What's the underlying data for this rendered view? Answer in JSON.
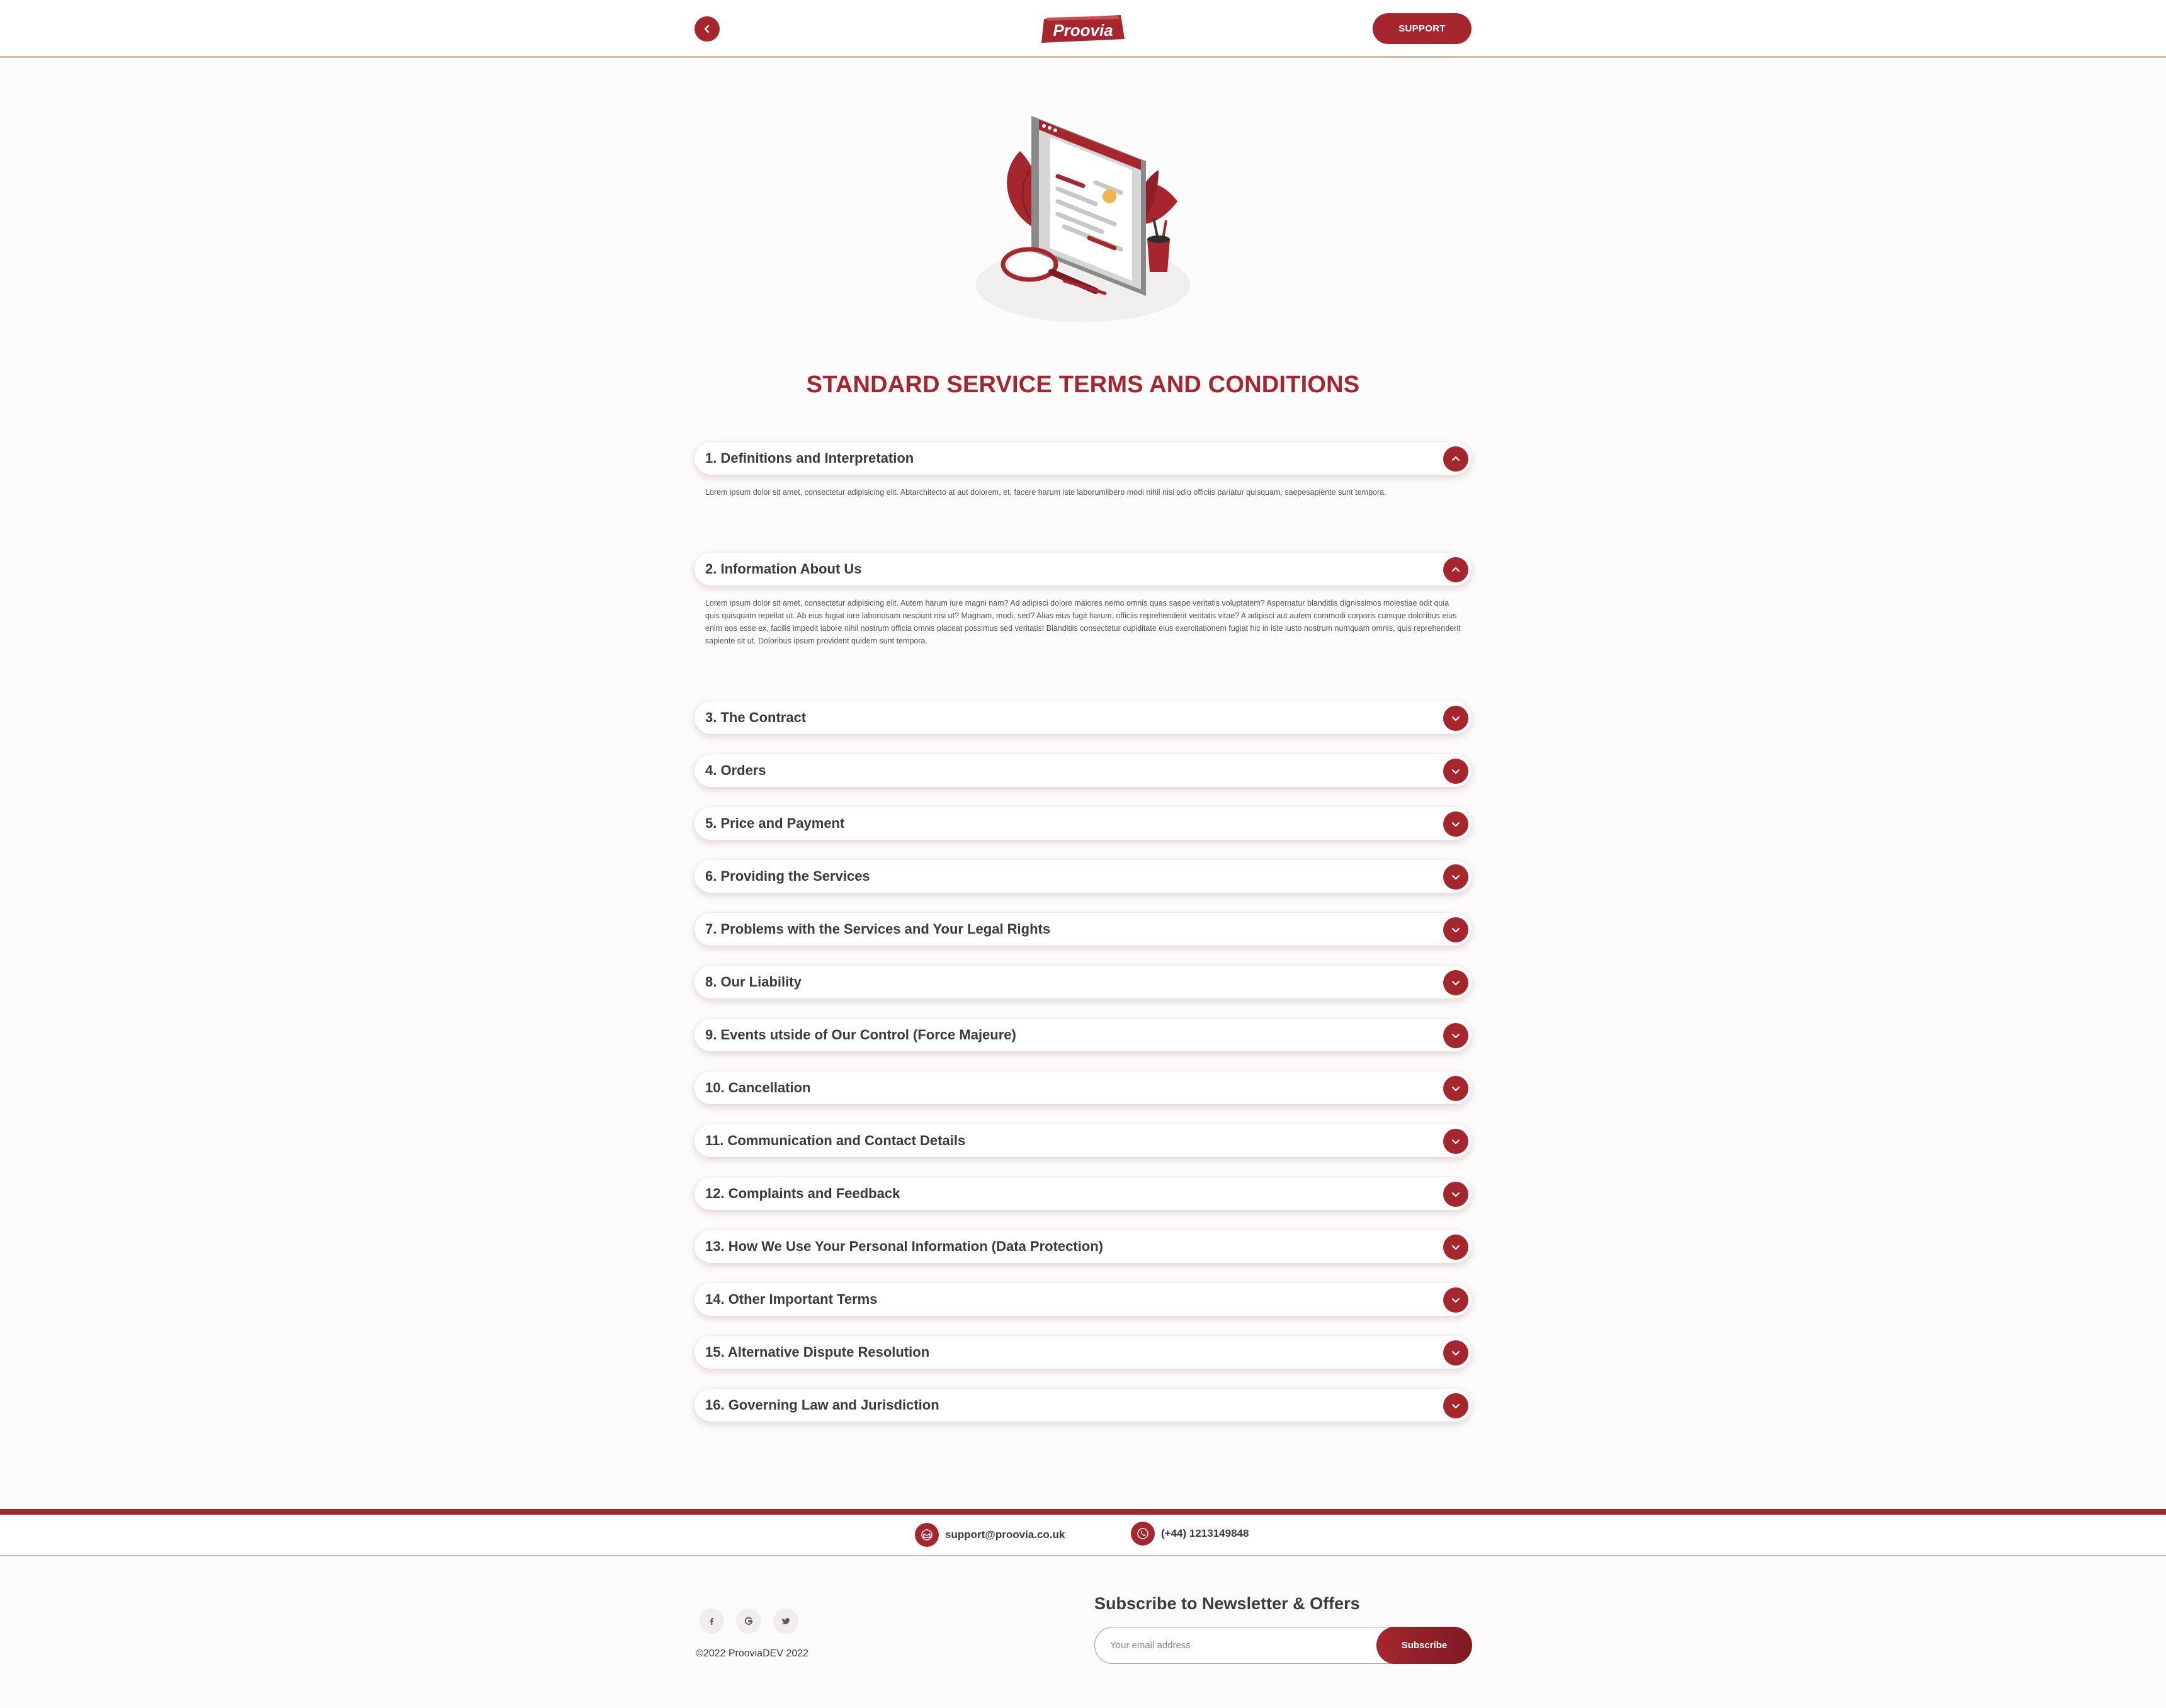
{
  "header": {
    "back_icon": "chevron-left-icon",
    "logo_text": "Proovia",
    "support_label": "SUPPORT"
  },
  "page": {
    "title": "STANDARD SERVICE TERMS AND CONDITIONS"
  },
  "accordion": {
    "items": [
      {
        "label": "1. Definitions and Interpretation",
        "expanded": true
      },
      {
        "label": "2. Information About Us",
        "expanded": true
      },
      {
        "label": "3. The Contract",
        "expanded": false
      },
      {
        "label": "4. Orders",
        "expanded": false
      },
      {
        "label": "5. Price and Payment",
        "expanded": false
      },
      {
        "label": "6. Providing the Services",
        "expanded": false
      },
      {
        "label": "7. Problems with the Services and Your Legal Rights",
        "expanded": false
      },
      {
        "label": "8. Our Liability",
        "expanded": false
      },
      {
        "label": "9. Events utside of Our Control (Force Majeure)",
        "expanded": false
      },
      {
        "label": "10. Cancellation",
        "expanded": false
      },
      {
        "label": "11. Communication and Contact Details",
        "expanded": false
      },
      {
        "label": "12. Complaints and Feedback",
        "expanded": false
      },
      {
        "label": "13. How We Use Your Personal Information (Data Protection)",
        "expanded": false
      },
      {
        "label": "14. Other Important Terms",
        "expanded": false
      },
      {
        "label": "15. Alternative Dispute Resolution",
        "expanded": false
      },
      {
        "label": "16. Governing Law and Jurisdiction",
        "expanded": false
      }
    ],
    "body_1": "Lorem ipsum dolor sit amet, consectetur adipisicing elit. Abtarchitecto at aut dolorem, et, facere harum iste laborumlibero modi nihil nisi odio officiis pariatur quisquam, saepesapiente sunt tempora.",
    "body_2": "Lorem ipsum dolor sit amet, consectetur adipisicing elit. Autem harum iure magni nam? Ad adipisci dolore maiores nemo omnis quas saepe veritatis voluptatem? Aspernatur blanditiis dignissimos molestiae odit quia quis quisquam repellat ut. Ab eius fugiat iure laboriosam nesciunt nisi ut? Magnam, modi, sed? Alias eius fugit harum, officiis reprehenderit veritatis vitae? A adipisci aut autem commodi corporis cumque doloribus eius enim eos esse ex, facilis impedit labore nihil nostrum officia omnis placeat possimus sed veritatis! Blanditiis consectetur cupiditate eius exercitationem fugiat hic in iste iusto nostrum numquam omnis, quis reprehenderit sapiente sit ut. Doloribus ipsum provident quidem sunt tempora."
  },
  "footer": {
    "email": "support@proovia.co.uk",
    "phone": "(+44) 1213149848",
    "social": [
      "facebook-icon",
      "google-icon",
      "twitter-icon"
    ],
    "copyright": "©2022 ProoviaDEV 2022",
    "newsletter_title": "Subscribe to Newsletter & Offers",
    "newsletter_placeholder": "Your email address",
    "subscribe_label": "Subscribe"
  },
  "colors": {
    "accent": "#a6262e",
    "background": "#fcfbfb",
    "text": "#3b3b3b"
  }
}
